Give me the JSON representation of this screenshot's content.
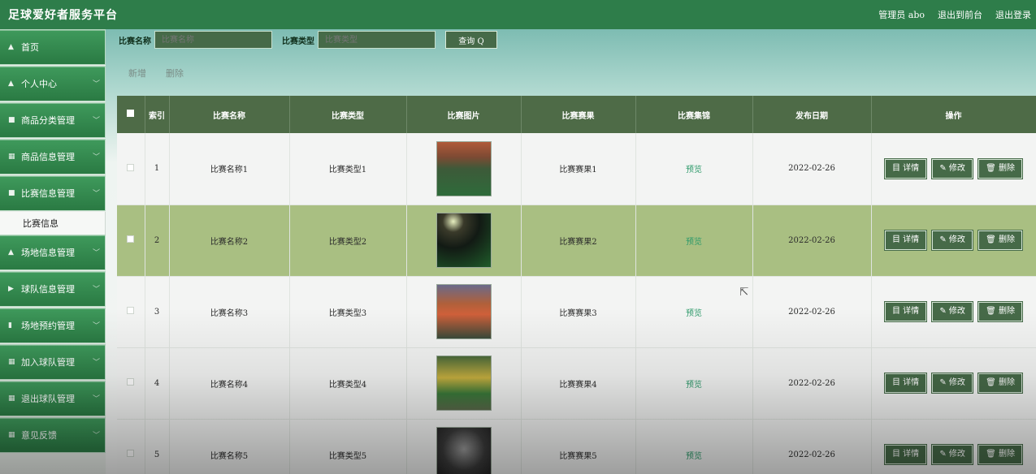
{
  "header": {
    "title": "足球爱好者服务平台",
    "admin_label": "管理员 abo",
    "to_front": "退出到前台",
    "logout": "退出登录"
  },
  "sidebar": {
    "items": [
      {
        "label": "首页",
        "icon": "home-icon"
      },
      {
        "label": "个人中心",
        "icon": "user-icon"
      },
      {
        "label": "商品分类管理",
        "icon": "list-icon"
      },
      {
        "label": "商品信息管理",
        "icon": "grid-icon"
      },
      {
        "label": "比赛信息管理",
        "icon": "doc-icon"
      },
      {
        "label": "场地信息管理",
        "icon": "user-icon"
      },
      {
        "label": "球队信息管理",
        "icon": "flag-icon"
      },
      {
        "label": "场地预约管理",
        "icon": "chart-icon"
      },
      {
        "label": "加入球队管理",
        "icon": "grid-icon"
      },
      {
        "label": "退出球队管理",
        "icon": "grid-icon"
      },
      {
        "label": "意见反馈",
        "icon": "grid-icon"
      }
    ],
    "sub_item": "比赛信息"
  },
  "search": {
    "name_label": "比赛名称",
    "name_placeholder": "比赛名称",
    "type_label": "比赛类型",
    "type_placeholder": "比赛类型",
    "button": "查询 Q"
  },
  "actions": {
    "add": "新增",
    "delete": "删除"
  },
  "table": {
    "headers": [
      "索引",
      "比赛名称",
      "比赛类型",
      "比赛图片",
      "比赛赛果",
      "比赛集锦",
      "发布日期",
      "操作"
    ],
    "rows": [
      {
        "index": "1",
        "name": "比赛名称1",
        "type": "比赛类型1",
        "result": "比赛赛果1",
        "highlight": "预览",
        "date": "2022-02-26"
      },
      {
        "index": "2",
        "name": "比赛名称2",
        "type": "比赛类型2",
        "result": "比赛赛果2",
        "highlight": "预览",
        "date": "2022-02-26"
      },
      {
        "index": "3",
        "name": "比赛名称3",
        "type": "比赛类型3",
        "result": "比赛赛果3",
        "highlight": "预览",
        "date": "2022-02-26"
      },
      {
        "index": "4",
        "name": "比赛名称4",
        "type": "比赛类型4",
        "result": "比赛赛果4",
        "highlight": "预览",
        "date": "2022-02-26"
      },
      {
        "index": "5",
        "name": "比赛名称5",
        "type": "比赛类型5",
        "result": "比赛赛果5",
        "highlight": "预览",
        "date": "2022-02-26"
      }
    ],
    "op_detail": "目 详情",
    "op_edit": "✎ 修改",
    "op_delete": "🗑 删除"
  },
  "colors": {
    "topbar": "#2e7d4a",
    "header_row": "#4e6b47",
    "alt_row": "#a9bf82",
    "button": "#466a48",
    "link": "#2d9a6a"
  }
}
